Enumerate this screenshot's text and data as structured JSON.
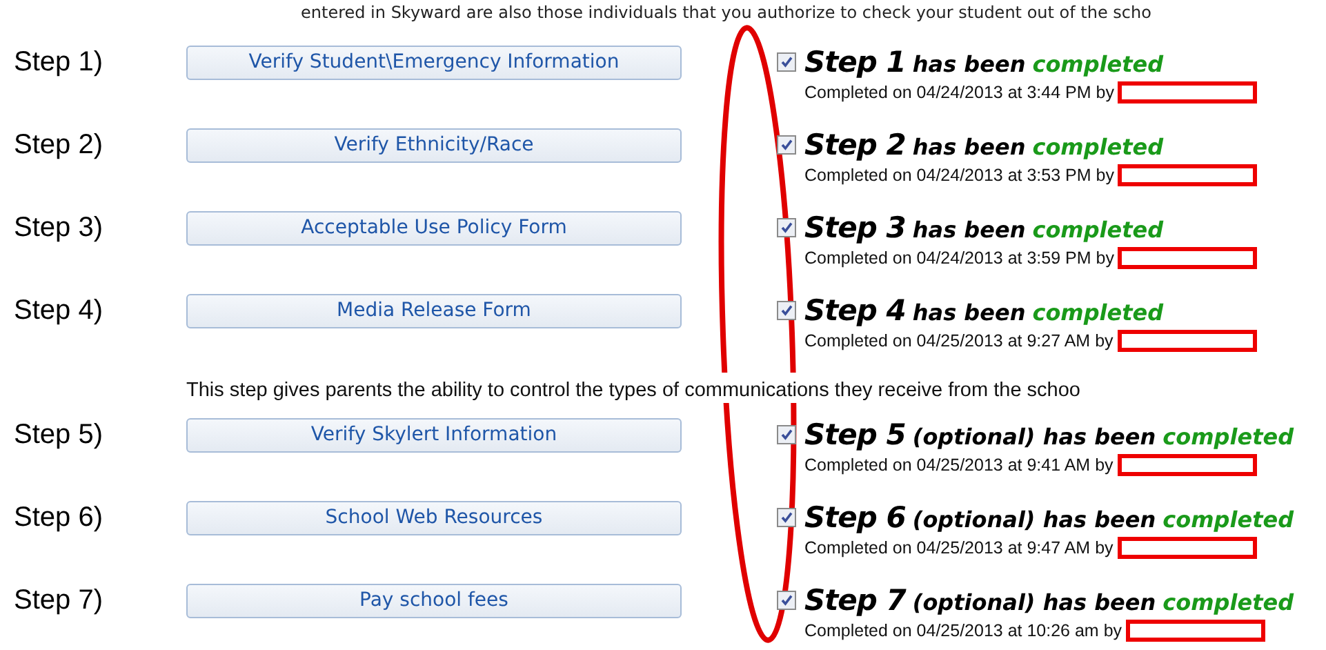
{
  "intro": "entered in Skyward are also those individuals that you authorize to check your student out of the scho",
  "items": [
    {
      "kind": "step",
      "label": "Step 1)",
      "button": "Verify Student\\Emergency Information",
      "checked": true,
      "step": "Step 1",
      "middle": "has been",
      "status": "completed",
      "completed_line": "Completed on 04/24/2013 at 3:44 PM by"
    },
    {
      "kind": "step",
      "label": "Step 2)",
      "button": "Verify Ethnicity/Race",
      "checked": true,
      "step": "Step 2",
      "middle": "has been",
      "status": "completed",
      "completed_line": "Completed on 04/24/2013 at 3:53 PM by"
    },
    {
      "kind": "step",
      "label": "Step 3)",
      "button": "Acceptable Use Policy Form",
      "checked": true,
      "step": "Step 3",
      "middle": "has been",
      "status": "completed",
      "completed_line": "Completed on 04/24/2013 at 3:59 PM by"
    },
    {
      "kind": "step",
      "label": "Step 4)",
      "button": "Media Release Form",
      "checked": true,
      "step": "Step 4",
      "middle": "has been",
      "status": "completed",
      "completed_line": "Completed on 04/25/2013 at 9:27 AM by"
    },
    {
      "kind": "note",
      "text": "This step gives parents the ability to control the types of communications they receive from the schoo"
    },
    {
      "kind": "step",
      "label": "Step 5)",
      "button": "Verify Skylert Information",
      "checked": true,
      "step": "Step 5",
      "middle": "(optional) has been",
      "status": "completed",
      "completed_line": "Completed on 04/25/2013 at 9:41 AM by"
    },
    {
      "kind": "step",
      "label": "Step 6)",
      "button": "School Web Resources",
      "checked": true,
      "step": "Step 6",
      "middle": "(optional) has been",
      "status": "completed",
      "completed_line": "Completed on 04/25/2013 at 9:47 AM by"
    },
    {
      "kind": "step",
      "label": "Step 7)",
      "button": "Pay school fees",
      "checked": true,
      "step": "Step 7",
      "middle": "(optional) has been",
      "status": "completed",
      "completed_line": "Completed on 04/25/2013 at 10:26 am by"
    }
  ],
  "annotation": {
    "kind": "ellipse"
  }
}
